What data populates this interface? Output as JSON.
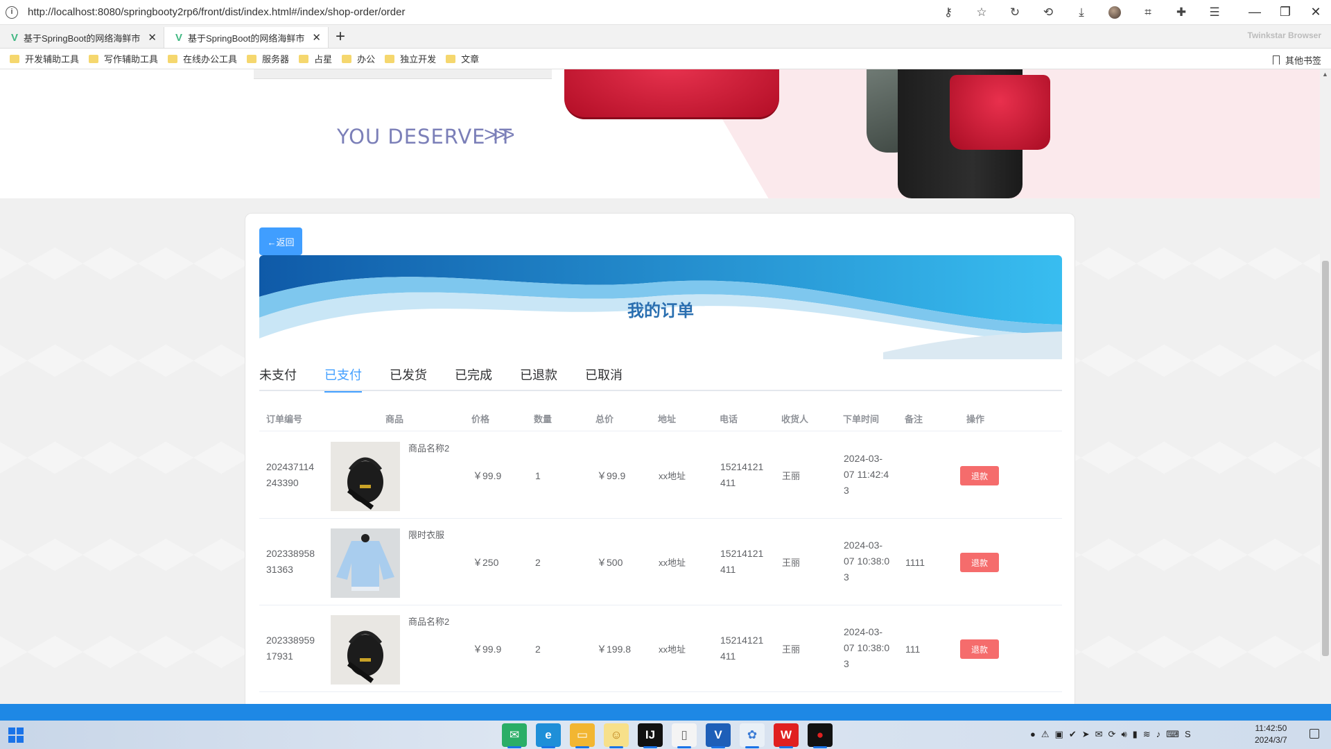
{
  "browser": {
    "url": "http://localhost:8080/springbooty2rp6/front/dist/index.html#/index/shop-order/order",
    "tabs": [
      {
        "title": "基于SpringBoot的网络海鲜市",
        "active": false
      },
      {
        "title": "基于SpringBoot的网络海鲜市",
        "active": true
      }
    ],
    "brand": "Twinkstar Browser",
    "bookmarks": [
      "开发辅助工具",
      "写作辅助工具",
      "在线办公工具",
      "服务器",
      "占星",
      "办公",
      "独立开发",
      "文章"
    ],
    "other_bookmarks": "其他书签",
    "icons": [
      "key-icon",
      "star-icon",
      "reload-icon",
      "history-icon",
      "download-icon",
      "profile-icon",
      "crop-icon",
      "extension-icon",
      "menu-icon"
    ]
  },
  "banner": {
    "slogan": "YOU DESERVE IT",
    "chevrons": ">>>"
  },
  "order_page": {
    "back_label": "←返回",
    "title": "我的订单",
    "tabs": [
      "未支付",
      "已支付",
      "已发货",
      "已完成",
      "已退款",
      "已取消"
    ],
    "active_tab": "已支付",
    "columns": [
      "订单编号",
      "商品",
      "价格",
      "数量",
      "总价",
      "地址",
      "电话",
      "收货人",
      "下单时间",
      "备注",
      "操作"
    ],
    "rows": [
      {
        "order_no_1": "202437114",
        "order_no_2": "243390",
        "product": "商品名称2",
        "product_image": "black-backpack",
        "price": "￥99.9",
        "qty": "1",
        "total": "￥99.9",
        "address": "xx地址",
        "phone_1": "15214121",
        "phone_2": "411",
        "receiver": "王丽",
        "time_1": "2024-03-",
        "time_2": "07 11:42:4",
        "time_3": "3",
        "remark": "",
        "action": "退款"
      },
      {
        "order_no_1": "202338958",
        "order_no_2": "31363",
        "product": "限时衣服",
        "product_image": "blue-shirt",
        "price": "￥250",
        "qty": "2",
        "total": "￥500",
        "address": "xx地址",
        "phone_1": "15214121",
        "phone_2": "411",
        "receiver": "王丽",
        "time_1": "2024-03-",
        "time_2": "07 10:38:0",
        "time_3": "3",
        "remark": "1111",
        "action": "退款"
      },
      {
        "order_no_1": "202338959",
        "order_no_2": "17931",
        "product": "商品名称2",
        "product_image": "black-backpack",
        "price": "￥99.9",
        "qty": "2",
        "total": "￥199.8",
        "address": "xx地址",
        "phone_1": "15214121",
        "phone_2": "411",
        "receiver": "王丽",
        "time_1": "2024-03-",
        "time_2": "07 10:38:0",
        "time_3": "3",
        "remark": "111",
        "action": "退款"
      }
    ]
  },
  "taskbar": {
    "time": "11:42:50",
    "date": "2024/3/7",
    "apps": [
      "wechat-icon",
      "edge-icon",
      "folder-icon",
      "fox-icon",
      "intellij-icon",
      "file-icon",
      "vscode-icon",
      "network-icon",
      "wps-icon",
      "record-icon"
    ]
  },
  "colors": {
    "primary": "#409eff",
    "danger": "#f56c6c",
    "footer": "#1e88e5",
    "title": "#2a6fb0"
  }
}
